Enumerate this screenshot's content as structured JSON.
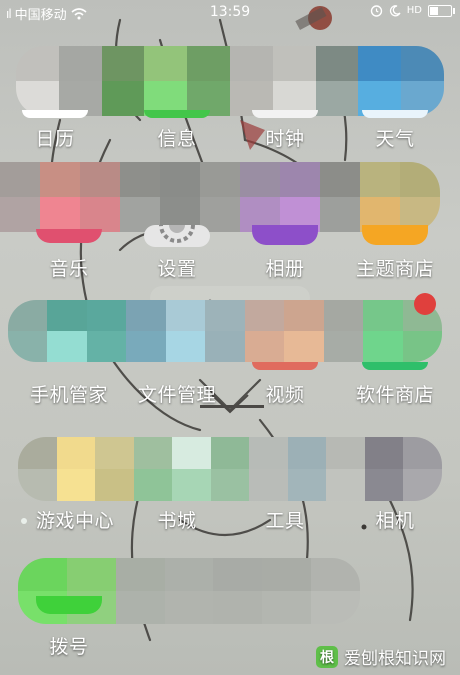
{
  "status_bar": {
    "carrier": "中国移动",
    "time": "13:59",
    "signal_label": "ıl",
    "hd_label": "HD"
  },
  "apps": [
    {
      "id": "calendar",
      "label": "日历"
    },
    {
      "id": "messages",
      "label": "信息"
    },
    {
      "id": "clock",
      "label": "时钟"
    },
    {
      "id": "weather",
      "label": "天气"
    },
    {
      "id": "music",
      "label": "音乐"
    },
    {
      "id": "settings",
      "label": "设置"
    },
    {
      "id": "gallery",
      "label": "相册"
    },
    {
      "id": "theme-store",
      "label": "主题商店"
    },
    {
      "id": "phone-manager",
      "label": "手机管家"
    },
    {
      "id": "file-manager",
      "label": "文件管理"
    },
    {
      "id": "video",
      "label": "视频"
    },
    {
      "id": "app-store",
      "label": "软件商店"
    },
    {
      "id": "game-center",
      "label": "游戏中心"
    },
    {
      "id": "bookstore",
      "label": "书城"
    },
    {
      "id": "tools",
      "label": "工具"
    },
    {
      "id": "camera",
      "label": "相机"
    },
    {
      "id": "dialer",
      "label": "拨号"
    }
  ],
  "watermark": {
    "text": "爱刨根知识网",
    "logo": "根"
  },
  "colors": {
    "label": "#ffffff",
    "badge": "#e0403d"
  }
}
